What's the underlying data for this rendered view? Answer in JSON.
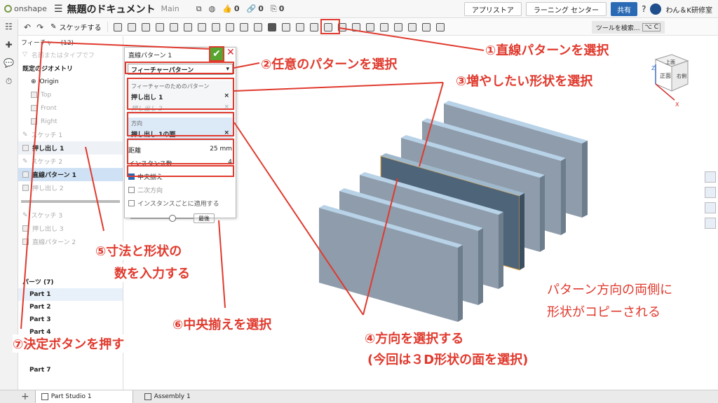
{
  "topbar": {
    "logo": "onshape",
    "menu_icon": "hamburger-icon",
    "doc_title": "無題のドキュメント",
    "branch": "Main",
    "likes": "0",
    "links": "0",
    "copies": "0",
    "app_store": "アプリストア",
    "learning": "ラーニング センター",
    "share": "共有",
    "help": "?",
    "user": "わん＆K研修室"
  },
  "toolbar": {
    "sketch_label": "スケッチする",
    "search_label": "ツールを検索...",
    "search_shortcut": "⌥ C"
  },
  "feature_panel": {
    "header": "フィーチャー (12)",
    "filter_placeholder": "名前またはタイプでフ",
    "default_geometry": "既定のジオメトリ",
    "origin": "Origin",
    "top": "Top",
    "front": "Front",
    "right": "Right",
    "features": [
      "スケッチ 1",
      "押し出し 1",
      "スケッチ 2",
      "直線パターン 1",
      "押し出し 2",
      "スケッチ 3",
      "押し出し 3",
      "直線パターン 2"
    ],
    "parts_header": "パーツ (7)",
    "parts": [
      "Part 1",
      "Part 2",
      "Part 3",
      "Part 4",
      "Part 7"
    ]
  },
  "dialog": {
    "title": "直線パターン 1",
    "pattern_type": "フィーチャーパターン",
    "features_label": "フィーチャーのためのパターン",
    "feature_1": "押し出し 1",
    "feature_2": "押し出し 2",
    "direction_label": "方向",
    "direction_value": "押し出し 1の面",
    "distance_label": "距離",
    "distance_value": "25 mm",
    "instances_label": "インスタンス数",
    "instances_value": "4",
    "center_align": "中央揃え",
    "second_direction": "二次方向",
    "apply_per_instance": "インスタンスごとに適用する",
    "final_button": "最後"
  },
  "annotations": {
    "a1": "①直線パターンを選択",
    "a2": "②任意のパターンを選択",
    "a3": "③増やしたい形状を選択",
    "a4": "④方向を選択する",
    "a4b": "(今回は３D形状の面を選択)",
    "a5a": "⑤寸法と形状の",
    "a5b": "数を入力する",
    "a6": "⑥中央揃えを選択",
    "a7": "⑦決定ボタンを押す",
    "note1": "パターン方向の両側に",
    "note2": "形状がコピーされる"
  },
  "view_cube": {
    "top": "上面",
    "front": "正面",
    "right": "右側",
    "z": "Z",
    "x": "X"
  },
  "bottom_tabs": [
    "Part Studio 1",
    "Assembly 1"
  ],
  "colors": {
    "accent_red": "#e03a2e",
    "plate_face": "#8fa0b0",
    "plate_selected": "#4e6478",
    "ok_green": "#55a530"
  }
}
